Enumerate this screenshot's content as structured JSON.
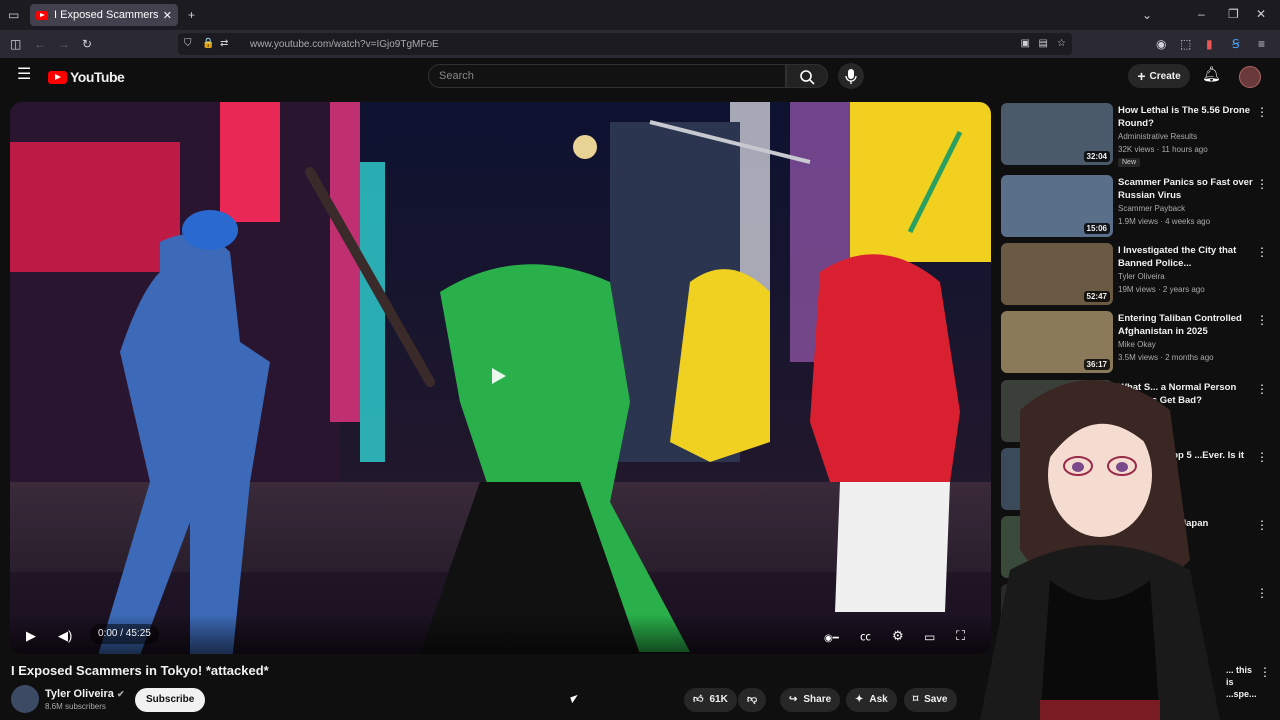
{
  "browser": {
    "tab_title": "I Exposed Scammers in Tokyo! *",
    "url": "www.youtube.com/watch?v=IGjo9TgMFoE",
    "new_tab": "+"
  },
  "youtube": {
    "logo_text": "YouTube",
    "search_placeholder": "Search",
    "create_label": "Create"
  },
  "video": {
    "time": "0:00 / 45:25",
    "title": "I Exposed Scammers in Tokyo! *attacked*",
    "channel": "Tyler Oliveira",
    "subscribers": "8.6M subscribers",
    "subscribe_label": "Subscribe",
    "likes": "61K",
    "share_label": "Share",
    "ask_label": "Ask",
    "save_label": "Save"
  },
  "recommendations": [
    {
      "title": "How Lethal is The 5.56 Drone Round?",
      "channel": "Administrative Results",
      "meta": "32K views · 11 hours ago",
      "duration": "32:04",
      "badge": "New",
      "color": "#4a5a6a"
    },
    {
      "title": "Scammer Panics so Fast over Russian Virus",
      "channel": "Scammer Payback",
      "meta": "1.9M views · 4 weeks ago",
      "duration": "15:06",
      "color": "#5a6f8a"
    },
    {
      "title": "I Investigated the City that Banned Police...",
      "channel": "Tyler Oliveira",
      "meta": "19M views · 2 years ago",
      "duration": "52:47",
      "color": "#6a5a44"
    },
    {
      "title": "Entering Taliban Controlled Afghanistan in 2025",
      "channel": "Mike Okay",
      "meta": "3.5M views · 2 months ago",
      "duration": "36:17",
      "color": "#8a7a5a"
    },
    {
      "title": "What S... a Normal Person ...Things Get Bad?",
      "channel": "...nb",
      "meta": "6 days ago",
      "color": "#3a3f3a"
    },
    {
      "title": "...cked the Top 5 ...Ever. Is it Wrong?",
      "channel": "",
      "meta": "2 days ago",
      "color": "#3a4a5a"
    },
    {
      "title": "...ery Drink in Japan",
      "channel": "",
      "meta": "...ago",
      "color": "#3a4a3a"
    },
    {
      "title": "...ns in",
      "channel": "",
      "meta": "",
      "color": "#2a2a2a"
    }
  ],
  "cut_title": "... this is ...spe..."
}
